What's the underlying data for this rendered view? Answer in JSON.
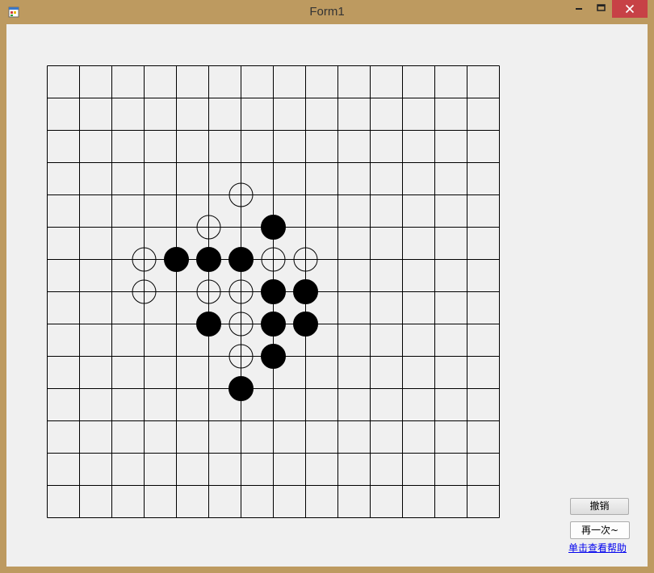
{
  "window": {
    "title": "Form1",
    "icon": "winforms-app-icon",
    "controls": {
      "minimize": "minimize-icon",
      "maximize": "maximize-icon",
      "close": "close-icon",
      "close_color": "#c74146"
    },
    "frame_color": "#bd9a60",
    "client_color": "#f0f0f0"
  },
  "board": {
    "cells": 14,
    "grid_color": "#000000",
    "black_stones": [
      {
        "row": 5,
        "col": 7
      },
      {
        "row": 6,
        "col": 4
      },
      {
        "row": 6,
        "col": 5
      },
      {
        "row": 6,
        "col": 6
      },
      {
        "row": 7,
        "col": 7
      },
      {
        "row": 7,
        "col": 8
      },
      {
        "row": 8,
        "col": 5
      },
      {
        "row": 8,
        "col": 7
      },
      {
        "row": 8,
        "col": 8
      },
      {
        "row": 9,
        "col": 7
      },
      {
        "row": 10,
        "col": 6
      }
    ],
    "white_stones": [
      {
        "row": 4,
        "col": 6
      },
      {
        "row": 5,
        "col": 5
      },
      {
        "row": 6,
        "col": 3
      },
      {
        "row": 6,
        "col": 7
      },
      {
        "row": 6,
        "col": 8
      },
      {
        "row": 7,
        "col": 3
      },
      {
        "row": 7,
        "col": 5
      },
      {
        "row": 7,
        "col": 6
      },
      {
        "row": 8,
        "col": 6
      },
      {
        "row": 9,
        "col": 6
      }
    ]
  },
  "buttons": {
    "undo_label": "撤销",
    "again_label": "再一次~"
  },
  "help_link": "单击查看帮助"
}
